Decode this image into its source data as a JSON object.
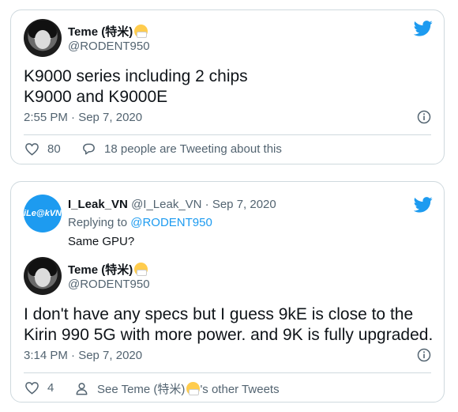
{
  "tweet1": {
    "author_name": "Teme (特米)",
    "author_handle": "@RODENT950",
    "text_line1": "K9000 series including 2 chips",
    "text_line2": "K9000 and K9000E",
    "timestamp": "2:55 PM · Sep 7, 2020",
    "likes": "80",
    "discussion": "18 people are Tweeting about this"
  },
  "tweet2": {
    "quoted": {
      "author_name": "I_Leak_VN",
      "author_handle_date": "@I_Leak_VN · Sep 7, 2020",
      "replying_prefix": "Replying to",
      "replying_to": "@RODENT950",
      "text": "Same GPU?",
      "avatar_label": "iLe@kVN"
    },
    "author_name": "Teme (特米)",
    "author_handle": "@RODENT950",
    "text_line1": "I don't have any specs but I guess 9kE is close to the",
    "text_line2": "Kirin 990 5G with more power. and 9K is fully upgraded.",
    "timestamp": "3:14 PM · Sep 7, 2020",
    "likes": "4",
    "see_more_prefix": "See Teme (特米)",
    "see_more_suffix": "'s other Tweets"
  },
  "icons": {
    "brand": "twitter-bird-icon",
    "info": "info-icon",
    "like": "heart-icon",
    "reply": "speech-bubble-icon",
    "profile": "person-icon"
  },
  "colors": {
    "accent": "#1d9bf0",
    "secondary_text": "#536471",
    "border": "#cfd9de"
  }
}
